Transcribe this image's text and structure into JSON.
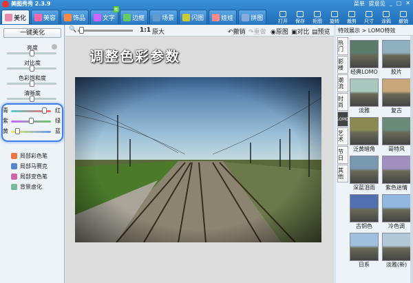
{
  "app": {
    "title": "美图秀秀 2.3.9",
    "menu": [
      "菜单",
      "提意见"
    ]
  },
  "tabs": [
    {
      "label": "美化",
      "icon": "palette-icon",
      "color": "#e8a",
      "active": true
    },
    {
      "label": "美容",
      "icon": "face-icon",
      "color": "#f6a"
    },
    {
      "label": "饰品",
      "icon": "ribbon-icon",
      "color": "#f84"
    },
    {
      "label": "文字",
      "icon": "text-icon",
      "color": "#c6f",
      "badge": "新"
    },
    {
      "label": "边框",
      "icon": "frame-icon",
      "color": "#6c6"
    },
    {
      "label": "场景",
      "icon": "scene-icon",
      "color": "#69c"
    },
    {
      "label": "闪图",
      "icon": "flash-icon",
      "color": "#cc3"
    },
    {
      "label": "娃娃",
      "icon": "doll-icon",
      "color": "#f88"
    },
    {
      "label": "拼图",
      "icon": "puzzle-icon",
      "color": "#8ad"
    }
  ],
  "tools": [
    "打开",
    "保存",
    "拒图",
    "旋转",
    "裁剪",
    "尺寸",
    "涂鸦",
    "撤销"
  ],
  "left": {
    "onekey": "一键美化",
    "sliders": [
      {
        "label": "亮度",
        "value": 0.5
      },
      {
        "label": "对比度",
        "value": 0.5
      },
      {
        "label": "色彩饱和度",
        "value": 0.5
      },
      {
        "label": "清晰度",
        "value": 0.5
      }
    ],
    "color_sliders": [
      {
        "l": "青",
        "r": "红",
        "value": 0.82,
        "grad": "linear-gradient(90deg,#5cc,#f66)"
      },
      {
        "l": "紫",
        "r": "绿",
        "value": 0.5,
        "grad": "linear-gradient(90deg,#c6f,#6c6)"
      },
      {
        "l": "黄",
        "r": "蓝",
        "value": 0.15,
        "grad": "linear-gradient(90deg,#ee5,#69f)"
      }
    ],
    "brushes": [
      {
        "label": "局部彩色笔",
        "color": "#e74"
      },
      {
        "label": "局部马赛克",
        "color": "#58c"
      },
      {
        "label": "局部变色笔",
        "color": "#c6a"
      },
      {
        "label": "背景虚化",
        "color": "#7b9"
      }
    ]
  },
  "canvas": {
    "toolbar": {
      "zoom": "1:1",
      "original": "原大",
      "undo": "撤销",
      "redo": "重做",
      "compare_orig": "原图",
      "compare": "对比",
      "preview": "预览"
    },
    "headline": "调整色彩参数"
  },
  "right": {
    "header": "特效展示 > LOMO特效",
    "vtabs": [
      "热门",
      "影楼",
      "潮流",
      "时尚",
      "LOMO",
      "艺术",
      "节日",
      "其他"
    ],
    "effects": [
      {
        "label": "经典LOMO",
        "c": "#5a7a6a"
      },
      {
        "label": "胶片",
        "c": "#8fb0c0"
      },
      {
        "label": "淡雅",
        "c": "#a8c8c0"
      },
      {
        "label": "复古",
        "c": "#c8a878"
      },
      {
        "label": "泛黄暗角",
        "c": "#8a8a50"
      },
      {
        "label": "哥特风",
        "c": "#6a8a7a"
      },
      {
        "label": "深蓝泪雨",
        "c": "#7898b0"
      },
      {
        "label": "紫色迷情",
        "c": "#a090c0"
      },
      {
        "label": "古铜色",
        "c": "#5070b0"
      },
      {
        "label": "冷色调",
        "c": "#90b8e0"
      },
      {
        "label": "日系",
        "c": "#a0c0e0"
      },
      {
        "label": "淡雅(新)",
        "c": "#b0c8d8"
      }
    ]
  }
}
